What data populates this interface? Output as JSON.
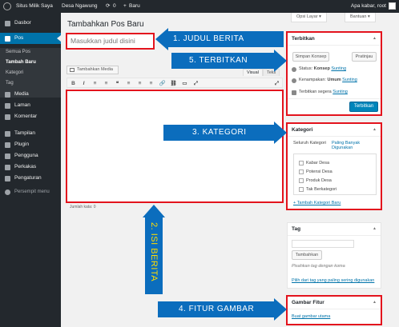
{
  "adminbar": {
    "site_name": "Situs Milik Saya",
    "site2_name": "Desa Ngawung",
    "comments_count": "0",
    "new_label": "Baru",
    "greeting": "Apa kabar, root"
  },
  "sidebar": {
    "items": [
      {
        "label": "Dasbor",
        "icon": "dashboard-icon"
      },
      {
        "label": "Pos",
        "icon": "pin-icon"
      },
      {
        "label": "Media",
        "icon": "media-icon"
      },
      {
        "label": "Laman",
        "icon": "page-icon"
      },
      {
        "label": "Komentar",
        "icon": "comment-icon"
      },
      {
        "label": "Tampilan",
        "icon": "brush-icon"
      },
      {
        "label": "Plugin",
        "icon": "plugin-icon"
      },
      {
        "label": "Pengguna",
        "icon": "users-icon"
      },
      {
        "label": "Perkakas",
        "icon": "wrench-icon"
      },
      {
        "label": "Pengaturan",
        "icon": "settings-icon"
      }
    ],
    "submenu": [
      "Semua Pos",
      "Tambah Baru",
      "Kategori",
      "Tag"
    ],
    "collapse_label": "Persempit menu"
  },
  "screen_options": {
    "options_label": "Opsi Layar",
    "help_label": "Bantuan"
  },
  "page_title": "Tambahkan Pos Baru",
  "editor": {
    "title_placeholder": "Masukkan judul disini",
    "add_media_label": "Tambahkan Media",
    "tab_visual": "Visual",
    "tab_text": "Teks",
    "toolbar": [
      "B",
      "I",
      "≡",
      "≡",
      "❝",
      "≡",
      "≡",
      "≡",
      "🔗",
      "⛓",
      "▭",
      "⤢"
    ],
    "word_count": "Jumlah kata: 0"
  },
  "publish_box": {
    "title": "Terbitkan",
    "save_draft": "Simpan Konsep",
    "preview": "Pratinjau",
    "status_label": "Status:",
    "status_value": "Konsep",
    "visibility_label": "Kenampakan:",
    "visibility_value": "Umum",
    "schedule_label": "Terbitkan segera",
    "edit_link": "Sunting",
    "publish_button": "Terbitkan"
  },
  "category_box": {
    "title": "Kategori",
    "tab_all": "Seluruh Kategori",
    "tab_popular": "Paling Banyak Digunakan",
    "items": [
      "Kabar Desa",
      "Potensi Desa",
      "Produk Desa",
      "Tak Berkategori"
    ],
    "add_link": "+ Tambah Kategori Baru"
  },
  "tag_box": {
    "title": "Tag",
    "add_button": "Tambahkan",
    "hint": "Pisahkan tag dengan koma",
    "popular_link": "Pilih dari tag yang paling sering digunakan"
  },
  "featured_box": {
    "title": "Gambar Fitur",
    "set_link": "Buat gambar utama"
  },
  "annotations": {
    "judul": "1.   JUDUL BERITA",
    "isi": "2. ISI BERITA",
    "kategori": "3.   KATEGORI",
    "gambar": "4.   FITUR GAMBAR",
    "terbitkan": "5.   TERBITKAN"
  },
  "colors": {
    "accent": "#0073aa",
    "arrow": "#0b6dbd",
    "highlight": "#e3131d",
    "label_yellow": "#ffdc00"
  }
}
